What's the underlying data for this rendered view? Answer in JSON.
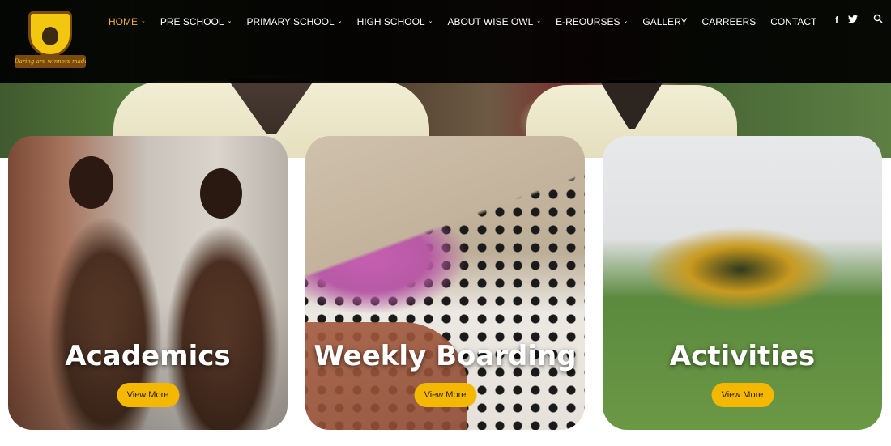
{
  "logo": {
    "motto": "Daring are winners made"
  },
  "nav": {
    "items": [
      {
        "label": "HOME",
        "dropdown": true,
        "active": true
      },
      {
        "label": "PRE SCHOOL",
        "dropdown": true
      },
      {
        "label": "PRIMARY SCHOOL",
        "dropdown": true
      },
      {
        "label": "HIGH SCHOOL",
        "dropdown": true
      },
      {
        "label": "ABOUT WISE OWL",
        "dropdown": true
      },
      {
        "label": "E-REOURSES",
        "dropdown": true
      },
      {
        "label": "GALLERY",
        "dropdown": false
      },
      {
        "label": "CARREERS",
        "dropdown": false
      },
      {
        "label": "CONTACT",
        "dropdown": false
      }
    ],
    "caret_glyph": "⌄",
    "social": {
      "facebook": "f",
      "twitter": "🐦",
      "search": "🔍"
    }
  },
  "cards": [
    {
      "title": "Academics",
      "button": "View More"
    },
    {
      "title": "Weekly Boarding",
      "button": "View More"
    },
    {
      "title": "Activities",
      "button": "View More"
    }
  ],
  "colors": {
    "accent": "#f5b800",
    "nav_active": "#f0b030",
    "nav_bg": "#000000"
  }
}
